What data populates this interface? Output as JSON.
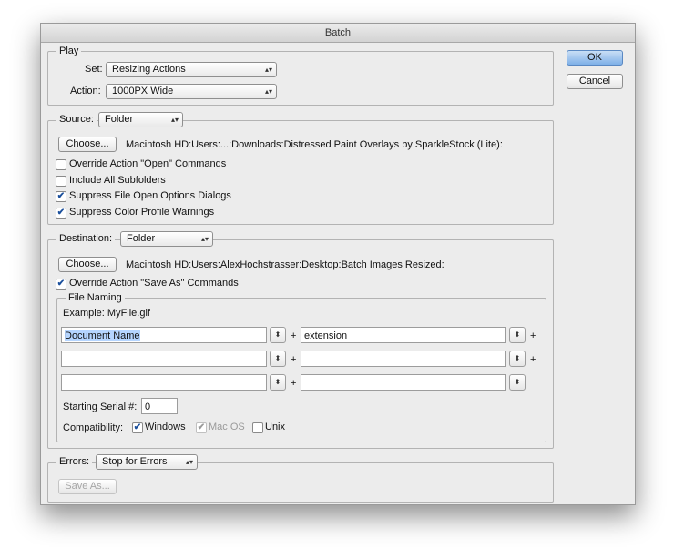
{
  "window": {
    "title": "Batch"
  },
  "buttons": {
    "ok": "OK",
    "cancel": "Cancel"
  },
  "play": {
    "legend": "Play",
    "set_label": "Set:",
    "set_value": "Resizing Actions",
    "action_label": "Action:",
    "action_value": "1000PX Wide"
  },
  "source": {
    "label": "Source:",
    "value": "Folder",
    "choose": "Choose...",
    "path": "Macintosh HD:Users:...:Downloads:Distressed Paint Overlays by SparkleStock (Lite):",
    "options": [
      {
        "label": "Override Action \"Open\" Commands",
        "checked": false
      },
      {
        "label": "Include All Subfolders",
        "checked": false
      },
      {
        "label": "Suppress File Open Options Dialogs",
        "checked": true
      },
      {
        "label": "Suppress Color Profile Warnings",
        "checked": true
      }
    ]
  },
  "destination": {
    "label": "Destination:",
    "value": "Folder",
    "choose": "Choose...",
    "path": "Macintosh HD:Users:AlexHochstrasser:Desktop:Batch Images Resized:",
    "override": {
      "label": "Override Action \"Save As\" Commands",
      "checked": true
    }
  },
  "file_naming": {
    "legend": "File Naming",
    "example": "Example: MyFile.gif",
    "fields": [
      {
        "left": "Document Name",
        "right": "extension"
      },
      {
        "left": "",
        "right": ""
      },
      {
        "left": "",
        "right": ""
      }
    ],
    "plus": "+",
    "serial_label": "Starting Serial #:",
    "serial_value": "0",
    "compat_label": "Compatibility:",
    "compat": [
      {
        "label": "Windows",
        "checked": true,
        "disabled": false
      },
      {
        "label": "Mac OS",
        "checked": true,
        "disabled": true
      },
      {
        "label": "Unix",
        "checked": false,
        "disabled": false
      }
    ]
  },
  "errors": {
    "label": "Errors:",
    "value": "Stop for Errors",
    "save_as": "Save As..."
  },
  "glyphs": {
    "check": "✔",
    "updown": "▴▾",
    "stepper": "⬍"
  }
}
